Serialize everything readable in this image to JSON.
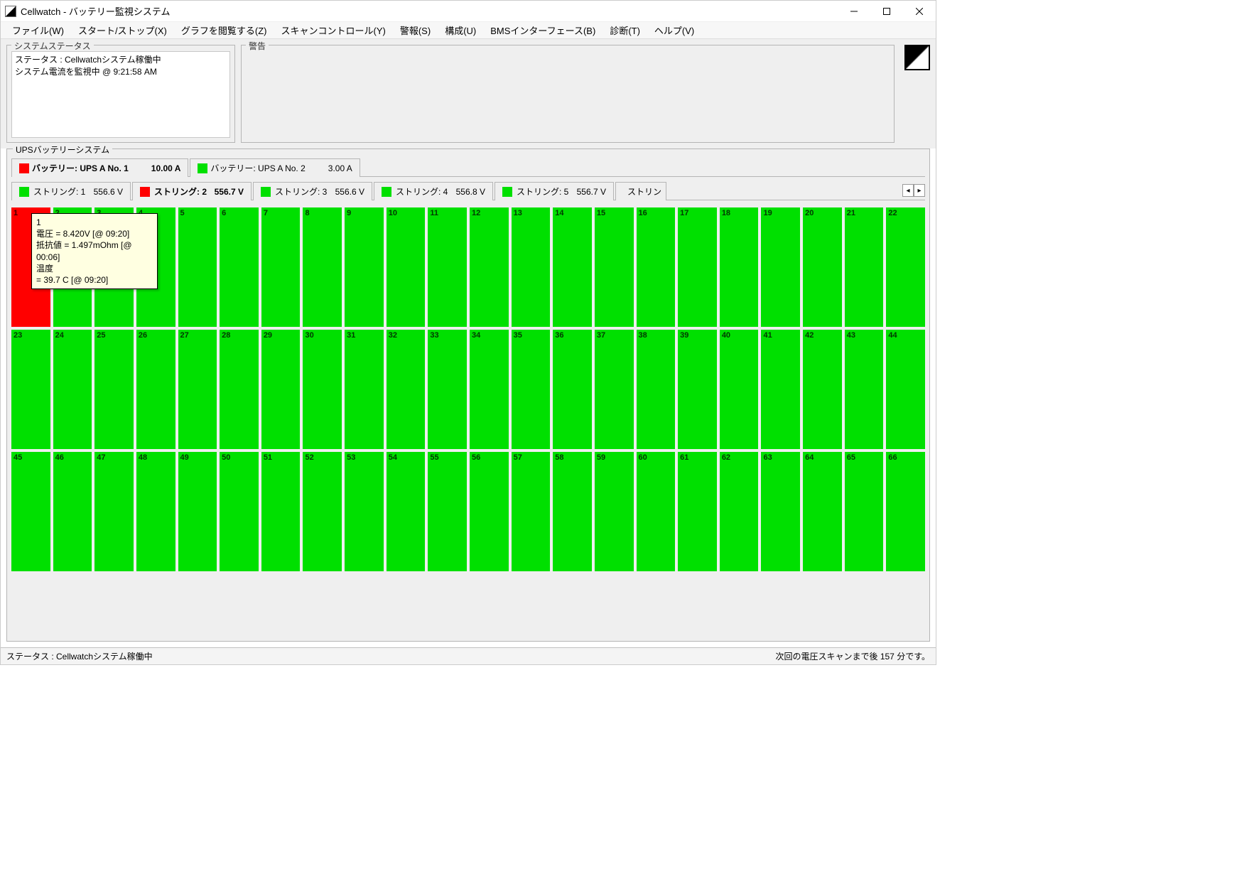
{
  "window": {
    "title": "Cellwatch - バッテリー監視システム"
  },
  "menu": {
    "file": "ファイル(W)",
    "startstop": "スタート/ストップ(X)",
    "graph": "グラフを閲覧する(Z)",
    "scan": "スキャンコントロール(Y)",
    "alarm": "警報(S)",
    "config": "構成(U)",
    "bms": "BMSインターフェース(B)",
    "diag": "診断(T)",
    "help": "ヘルプ(V)"
  },
  "panels": {
    "status_title": "システムステータス",
    "status_line1": "ステータス : Cellwatchシステム稼働中",
    "status_line2": "システム電流を監視中 @ 9:21:58 AM",
    "warn_title": "警告"
  },
  "ups": {
    "group_title": "UPSバッテリーシステム",
    "batteries": [
      {
        "label": "バッテリー: UPS A No. 1",
        "amps": "10.00 A",
        "status": "red",
        "active": true
      },
      {
        "label": "バッテリー: UPS A No. 2",
        "amps": "3.00 A",
        "status": "green",
        "active": false
      }
    ],
    "strings": [
      {
        "label": "ストリング: 1",
        "volts": "556.6 V",
        "status": "green",
        "active": false
      },
      {
        "label": "ストリング: 2",
        "volts": "556.7 V",
        "status": "red",
        "active": true
      },
      {
        "label": "ストリング: 3",
        "volts": "556.6 V",
        "status": "green",
        "active": false
      },
      {
        "label": "ストリング: 4",
        "volts": "556.8 V",
        "status": "green",
        "active": false
      },
      {
        "label": "ストリング: 5",
        "volts": "556.7 V",
        "status": "green",
        "active": false
      }
    ],
    "string_partial_label": "ストリン",
    "cell_count": 66,
    "bad_cells": [
      1
    ],
    "tooltip": {
      "cell": "1",
      "voltage_line": "電圧 = 8.420V  [@ 09:20]",
      "resist_line": "抵抗値 = 1.497mOhm [@ 00:06]",
      "temp_label": "温度",
      "temp_value": "= 39.7 C [@ 09:20]"
    }
  },
  "statusbar": {
    "left": "ステータス : Cellwatchシステム稼働中",
    "right": "次回の電圧スキャンまで後 157 分です。"
  }
}
